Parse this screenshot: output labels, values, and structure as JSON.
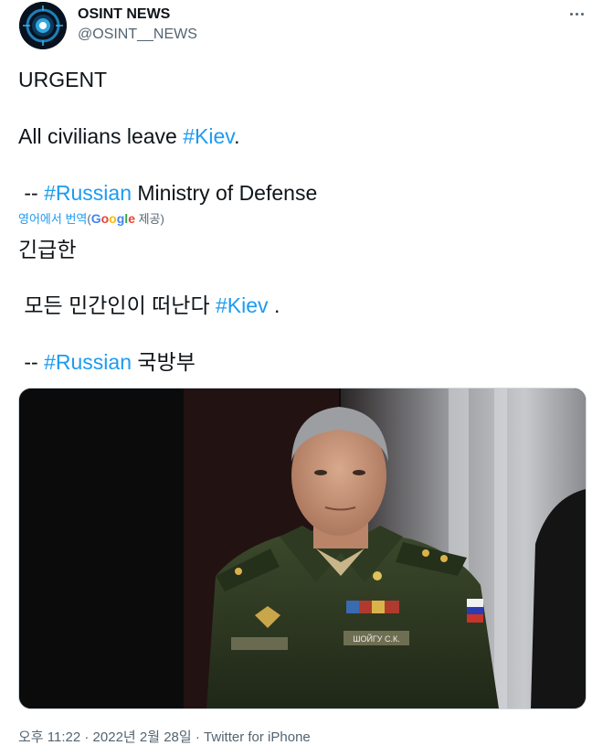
{
  "author": {
    "name": "OSINT NEWS",
    "handle": "@OSINT__NEWS",
    "avatar_icon": "eye-logo-icon"
  },
  "menu_icon": "more-horizontal-icon",
  "tweet": {
    "line1": "URGENT",
    "line2_pre": "All civilians leave ",
    "line2_tag": "#Kiev",
    "line2_post": ".",
    "line3_pre": " -- ",
    "line3_tag": "#Russian",
    "line3_post": " Ministry of Defense"
  },
  "translation": {
    "label": "영어에서 번역",
    "paren_open": "(",
    "google_letters": [
      "G",
      "o",
      "o",
      "g",
      "l",
      "e"
    ],
    "provided": " 제공)",
    "line1": "긴급한",
    "line2_pre": " 모든 민간인이 떠난다 ",
    "line2_tag": "#Kiev",
    "line2_post": " .",
    "line3_pre": " -- ",
    "line3_tag": "#Russian",
    "line3_post": " 국방부"
  },
  "media": {
    "nameplate": "ШОЙГУ С.К."
  },
  "footer": {
    "time": "오후 11:22",
    "sep1": " · ",
    "date": "2022년 2월 28일",
    "sep2": " · ",
    "source": "Twitter for iPhone"
  },
  "colors": {
    "link": "#1d9bf0",
    "text": "#0f1419",
    "secondary": "#536471"
  }
}
